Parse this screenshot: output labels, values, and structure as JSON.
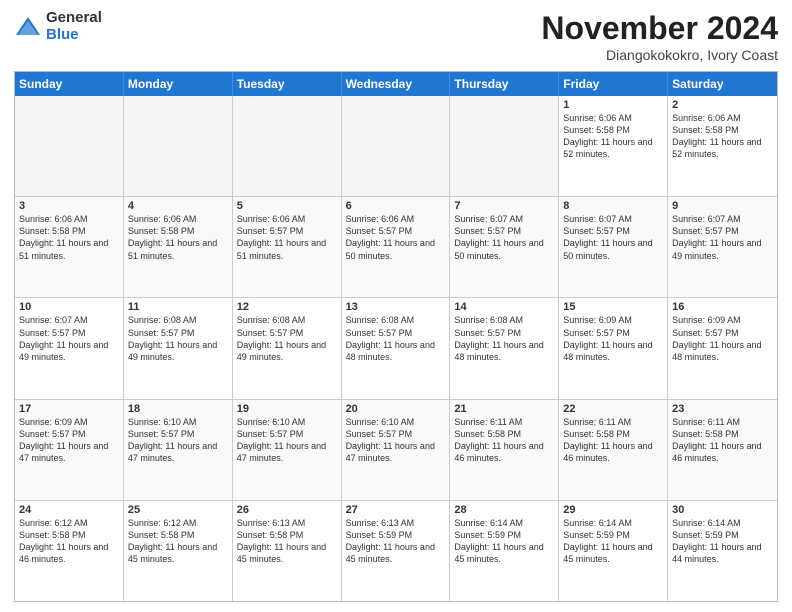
{
  "logo": {
    "general": "General",
    "blue": "Blue"
  },
  "title": "November 2024",
  "subtitle": "Diangokokokro, Ivory Coast",
  "days": [
    "Sunday",
    "Monday",
    "Tuesday",
    "Wednesday",
    "Thursday",
    "Friday",
    "Saturday"
  ],
  "weeks": [
    [
      {
        "day": "",
        "info": ""
      },
      {
        "day": "",
        "info": ""
      },
      {
        "day": "",
        "info": ""
      },
      {
        "day": "",
        "info": ""
      },
      {
        "day": "",
        "info": ""
      },
      {
        "day": "1",
        "info": "Sunrise: 6:06 AM\nSunset: 5:58 PM\nDaylight: 11 hours and 52 minutes."
      },
      {
        "day": "2",
        "info": "Sunrise: 6:06 AM\nSunset: 5:58 PM\nDaylight: 11 hours and 52 minutes."
      }
    ],
    [
      {
        "day": "3",
        "info": "Sunrise: 6:06 AM\nSunset: 5:58 PM\nDaylight: 11 hours and 51 minutes."
      },
      {
        "day": "4",
        "info": "Sunrise: 6:06 AM\nSunset: 5:58 PM\nDaylight: 11 hours and 51 minutes."
      },
      {
        "day": "5",
        "info": "Sunrise: 6:06 AM\nSunset: 5:57 PM\nDaylight: 11 hours and 51 minutes."
      },
      {
        "day": "6",
        "info": "Sunrise: 6:06 AM\nSunset: 5:57 PM\nDaylight: 11 hours and 50 minutes."
      },
      {
        "day": "7",
        "info": "Sunrise: 6:07 AM\nSunset: 5:57 PM\nDaylight: 11 hours and 50 minutes."
      },
      {
        "day": "8",
        "info": "Sunrise: 6:07 AM\nSunset: 5:57 PM\nDaylight: 11 hours and 50 minutes."
      },
      {
        "day": "9",
        "info": "Sunrise: 6:07 AM\nSunset: 5:57 PM\nDaylight: 11 hours and 49 minutes."
      }
    ],
    [
      {
        "day": "10",
        "info": "Sunrise: 6:07 AM\nSunset: 5:57 PM\nDaylight: 11 hours and 49 minutes."
      },
      {
        "day": "11",
        "info": "Sunrise: 6:08 AM\nSunset: 5:57 PM\nDaylight: 11 hours and 49 minutes."
      },
      {
        "day": "12",
        "info": "Sunrise: 6:08 AM\nSunset: 5:57 PM\nDaylight: 11 hours and 49 minutes."
      },
      {
        "day": "13",
        "info": "Sunrise: 6:08 AM\nSunset: 5:57 PM\nDaylight: 11 hours and 48 minutes."
      },
      {
        "day": "14",
        "info": "Sunrise: 6:08 AM\nSunset: 5:57 PM\nDaylight: 11 hours and 48 minutes."
      },
      {
        "day": "15",
        "info": "Sunrise: 6:09 AM\nSunset: 5:57 PM\nDaylight: 11 hours and 48 minutes."
      },
      {
        "day": "16",
        "info": "Sunrise: 6:09 AM\nSunset: 5:57 PM\nDaylight: 11 hours and 48 minutes."
      }
    ],
    [
      {
        "day": "17",
        "info": "Sunrise: 6:09 AM\nSunset: 5:57 PM\nDaylight: 11 hours and 47 minutes."
      },
      {
        "day": "18",
        "info": "Sunrise: 6:10 AM\nSunset: 5:57 PM\nDaylight: 11 hours and 47 minutes."
      },
      {
        "day": "19",
        "info": "Sunrise: 6:10 AM\nSunset: 5:57 PM\nDaylight: 11 hours and 47 minutes."
      },
      {
        "day": "20",
        "info": "Sunrise: 6:10 AM\nSunset: 5:57 PM\nDaylight: 11 hours and 47 minutes."
      },
      {
        "day": "21",
        "info": "Sunrise: 6:11 AM\nSunset: 5:58 PM\nDaylight: 11 hours and 46 minutes."
      },
      {
        "day": "22",
        "info": "Sunrise: 6:11 AM\nSunset: 5:58 PM\nDaylight: 11 hours and 46 minutes."
      },
      {
        "day": "23",
        "info": "Sunrise: 6:11 AM\nSunset: 5:58 PM\nDaylight: 11 hours and 46 minutes."
      }
    ],
    [
      {
        "day": "24",
        "info": "Sunrise: 6:12 AM\nSunset: 5:58 PM\nDaylight: 11 hours and 46 minutes."
      },
      {
        "day": "25",
        "info": "Sunrise: 6:12 AM\nSunset: 5:58 PM\nDaylight: 11 hours and 45 minutes."
      },
      {
        "day": "26",
        "info": "Sunrise: 6:13 AM\nSunset: 5:58 PM\nDaylight: 11 hours and 45 minutes."
      },
      {
        "day": "27",
        "info": "Sunrise: 6:13 AM\nSunset: 5:59 PM\nDaylight: 11 hours and 45 minutes."
      },
      {
        "day": "28",
        "info": "Sunrise: 6:14 AM\nSunset: 5:59 PM\nDaylight: 11 hours and 45 minutes."
      },
      {
        "day": "29",
        "info": "Sunrise: 6:14 AM\nSunset: 5:59 PM\nDaylight: 11 hours and 45 minutes."
      },
      {
        "day": "30",
        "info": "Sunrise: 6:14 AM\nSunset: 5:59 PM\nDaylight: 11 hours and 44 minutes."
      }
    ]
  ]
}
